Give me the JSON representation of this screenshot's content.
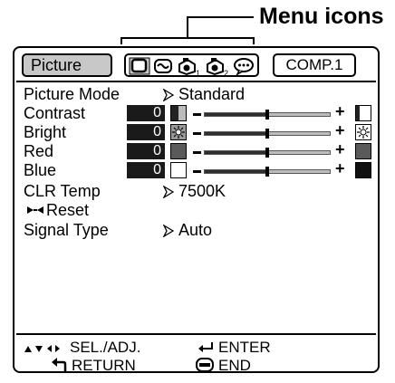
{
  "callout": {
    "label": "Menu icons"
  },
  "header": {
    "title_tab": "Picture",
    "input_tab": "COMP.1",
    "menu_icons": [
      "picture-icon",
      "fine-sync-icon",
      "projector-1-icon",
      "projector-2-icon",
      "speech-bubble-icon"
    ]
  },
  "settings": {
    "picture_mode": {
      "label": "Picture Mode",
      "value": "Standard"
    },
    "contrast": {
      "label": "Contrast",
      "value": "0",
      "level": 0.5
    },
    "bright": {
      "label": "Bright",
      "value": "0",
      "level": 0.5
    },
    "red": {
      "label": "Red",
      "value": "0",
      "level": 0.5
    },
    "blue": {
      "label": "Blue",
      "value": "0",
      "level": 0.5
    },
    "clr_temp": {
      "label": "CLR Temp",
      "value": "7500K"
    },
    "reset": {
      "label": "Reset"
    },
    "signal_type": {
      "label": "Signal Type",
      "value": "Auto"
    }
  },
  "footer": {
    "sel_adj": "SEL./ADJ.",
    "enter": "ENTER",
    "return": "RETURN",
    "end": "END"
  },
  "colors": {
    "value_box": "#1a1a1a",
    "tab_active": "#c8c8c8",
    "track_fill": "#2e2e2e",
    "track_empty": "#bdbdbd"
  }
}
